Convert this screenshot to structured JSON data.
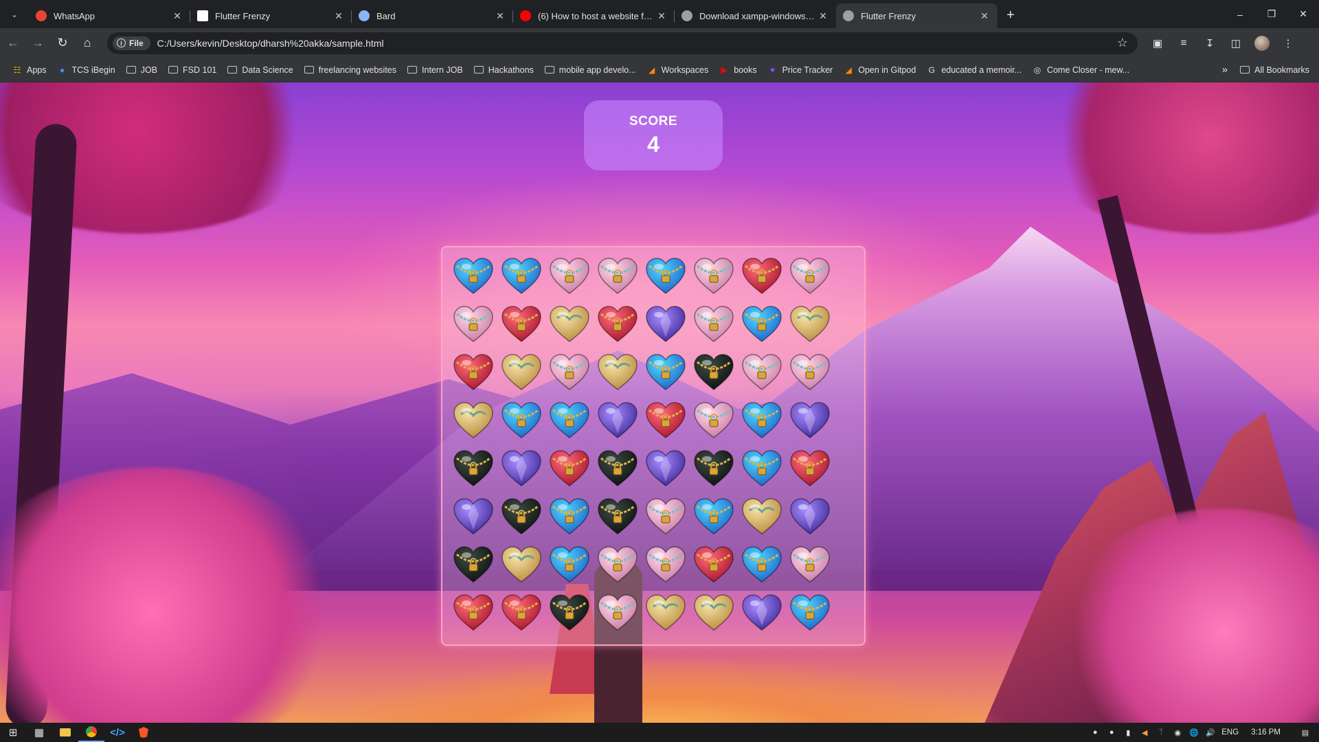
{
  "browser": {
    "tabs": [
      {
        "title": "WhatsApp",
        "favicon_color": "#e94435",
        "active": false
      },
      {
        "title": "Flutter Frenzy",
        "favicon_color": "#ffffff",
        "active": false
      },
      {
        "title": "Bard",
        "favicon_color": "#8ab4f8",
        "active": false
      },
      {
        "title": "(6) How to host a website from",
        "favicon_color": "#ff0000",
        "active": false
      },
      {
        "title": "Download xampp-windows-x64",
        "favicon_color": "#9aa0a6",
        "active": false
      },
      {
        "title": "Flutter Frenzy",
        "favicon_color": "#9aa0a6",
        "active": true
      }
    ],
    "omnibox": {
      "chip_label": "File",
      "url": "C:/Users/kevin/Desktop/dharsh%20akka/sample.html"
    },
    "bookmarks": [
      {
        "label": "Apps",
        "icon": "apps-grid-icon"
      },
      {
        "label": "TCS iBegin",
        "icon": "tcs-icon"
      },
      {
        "label": "JOB",
        "icon": "folder-icon"
      },
      {
        "label": "FSD 101",
        "icon": "folder-icon"
      },
      {
        "label": "Data Science",
        "icon": "folder-icon"
      },
      {
        "label": "freelancing websites",
        "icon": "folder-icon"
      },
      {
        "label": "Intern JOB",
        "icon": "folder-icon"
      },
      {
        "label": "Hackathons",
        "icon": "folder-icon"
      },
      {
        "label": "mobile app develo...",
        "icon": "folder-icon"
      },
      {
        "label": "Workspaces",
        "icon": "gitpod-icon"
      },
      {
        "label": "books",
        "icon": "youtube-icon"
      },
      {
        "label": "Price Tracker",
        "icon": "tracker-icon"
      },
      {
        "label": "Open in Gitpod",
        "icon": "gitpod-icon"
      },
      {
        "label": "educated a memoir...",
        "icon": "google-icon"
      },
      {
        "label": "Come Closer - mew...",
        "icon": "globe-icon"
      }
    ],
    "all_bookmarks_label": "All Bookmarks"
  },
  "game": {
    "score_label": "SCORE",
    "score_value": "4",
    "legend": {
      "B": "blue-heart-gold-lock",
      "T": "teal-chained-heart",
      "R": "red-locked-heart",
      "G": "gold-floral-heart",
      "P": "purple-feathered-heart",
      "K": "black-heart-gold-chains"
    },
    "colors": {
      "B": [
        "#4fd7ff",
        "#1e63c9"
      ],
      "T": [
        "#ffd7e8",
        "#c97aa1"
      ],
      "R": [
        "#ff6b7a",
        "#a8142a"
      ],
      "G": [
        "#f6e3a6",
        "#b98a3e"
      ],
      "P": [
        "#a98cff",
        "#3d2a9a"
      ],
      "K": [
        "#3d4b44",
        "#0d1210"
      ]
    },
    "board": [
      [
        "B",
        "B",
        "T",
        "T",
        "B",
        "T",
        "R",
        "T"
      ],
      [
        "T",
        "R",
        "G",
        "R",
        "P",
        "T",
        "B",
        "G"
      ],
      [
        "R",
        "G",
        "T",
        "G",
        "B",
        "K",
        "T",
        "T"
      ],
      [
        "G",
        "B",
        "B",
        "P",
        "R",
        "T",
        "B",
        "P"
      ],
      [
        "K",
        "P",
        "R",
        "K",
        "P",
        "K",
        "B",
        "R"
      ],
      [
        "P",
        "K",
        "B",
        "K",
        "T",
        "B",
        "G",
        "P"
      ],
      [
        "K",
        "G",
        "B",
        "T",
        "T",
        "R",
        "B",
        "T"
      ],
      [
        "R",
        "R",
        "K",
        "T",
        "G",
        "G",
        "P",
        "B"
      ]
    ]
  },
  "taskbar": {
    "items": [
      "windows-start-icon",
      "task-view-icon",
      "file-explorer-icon",
      "chrome-icon",
      "vscode-icon",
      "brave-icon"
    ],
    "language": "ENG",
    "time": "3:16 PM"
  }
}
